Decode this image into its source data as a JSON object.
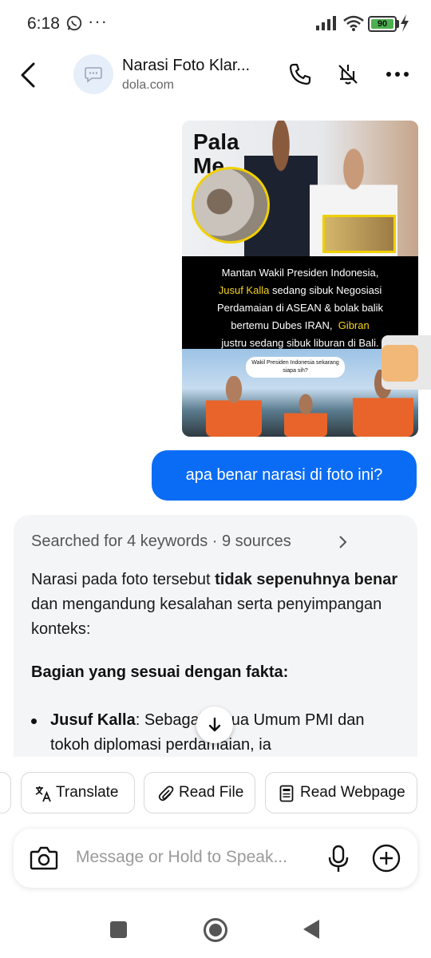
{
  "status_bar": {
    "time": "6:18",
    "battery": "90",
    "icons": [
      "whatsapp-icon",
      "more-dots-icon",
      "signal-icon",
      "wifi-icon",
      "battery-icon",
      "charging-icon"
    ]
  },
  "header": {
    "title": "Narasi Foto Klar...",
    "subtitle": "dola.com",
    "icons": [
      "back-icon",
      "chat-bubble-icon",
      "phone-icon",
      "mute-icon",
      "more-icon"
    ]
  },
  "chat": {
    "image_message": {
      "header_word": "Pala\nMe",
      "caption_lines": [
        {
          "text": "Mantan Wakil Presiden Indonesia,",
          "highlight": false
        },
        {
          "text": "Jusuf Kalla",
          "highlight": true,
          "rest": " sedang sibuk Negosiasi"
        },
        {
          "text": "Perdamaian di ASEAN & bolak balik",
          "highlight": false
        },
        {
          "text": "bertemu Dubes IRAN,",
          "highlight": false,
          "tail_highlight": "Gibran"
        },
        {
          "text": "justru sedang sibuk liburan di Bali.",
          "highlight": false
        }
      ],
      "inset_bubble": "Wakil Presiden Indonesia sekarang siapa sih?"
    },
    "user_message": "apa benar narasi di foto ini?",
    "answer": {
      "sources_label": "Searched for 4 keywords · 9 sources",
      "paragraph_pre": "Narasi pada foto tersebut ",
      "paragraph_bold": "tidak sepenuhnya benar",
      "paragraph_post": " dan mengandung kesalahan serta penyimpangan konteks:",
      "heading": "Bagian yang sesuai dengan fakta:",
      "bullet_bold": "Jusuf Kalla",
      "bullet_text": ": Sebagai Ketua Umum PMI dan tokoh diplomasi perdamaian, ia"
    }
  },
  "quick_actions": {
    "translate": "Translate",
    "read_file": "Read File",
    "read_webpage": "Read Webpage"
  },
  "input": {
    "placeholder": "Message or Hold to Speak..."
  },
  "colors": {
    "accent": "#0a6cf5",
    "caption_highlight": "#f6d31e",
    "answer_bg": "#f4f5f7"
  }
}
